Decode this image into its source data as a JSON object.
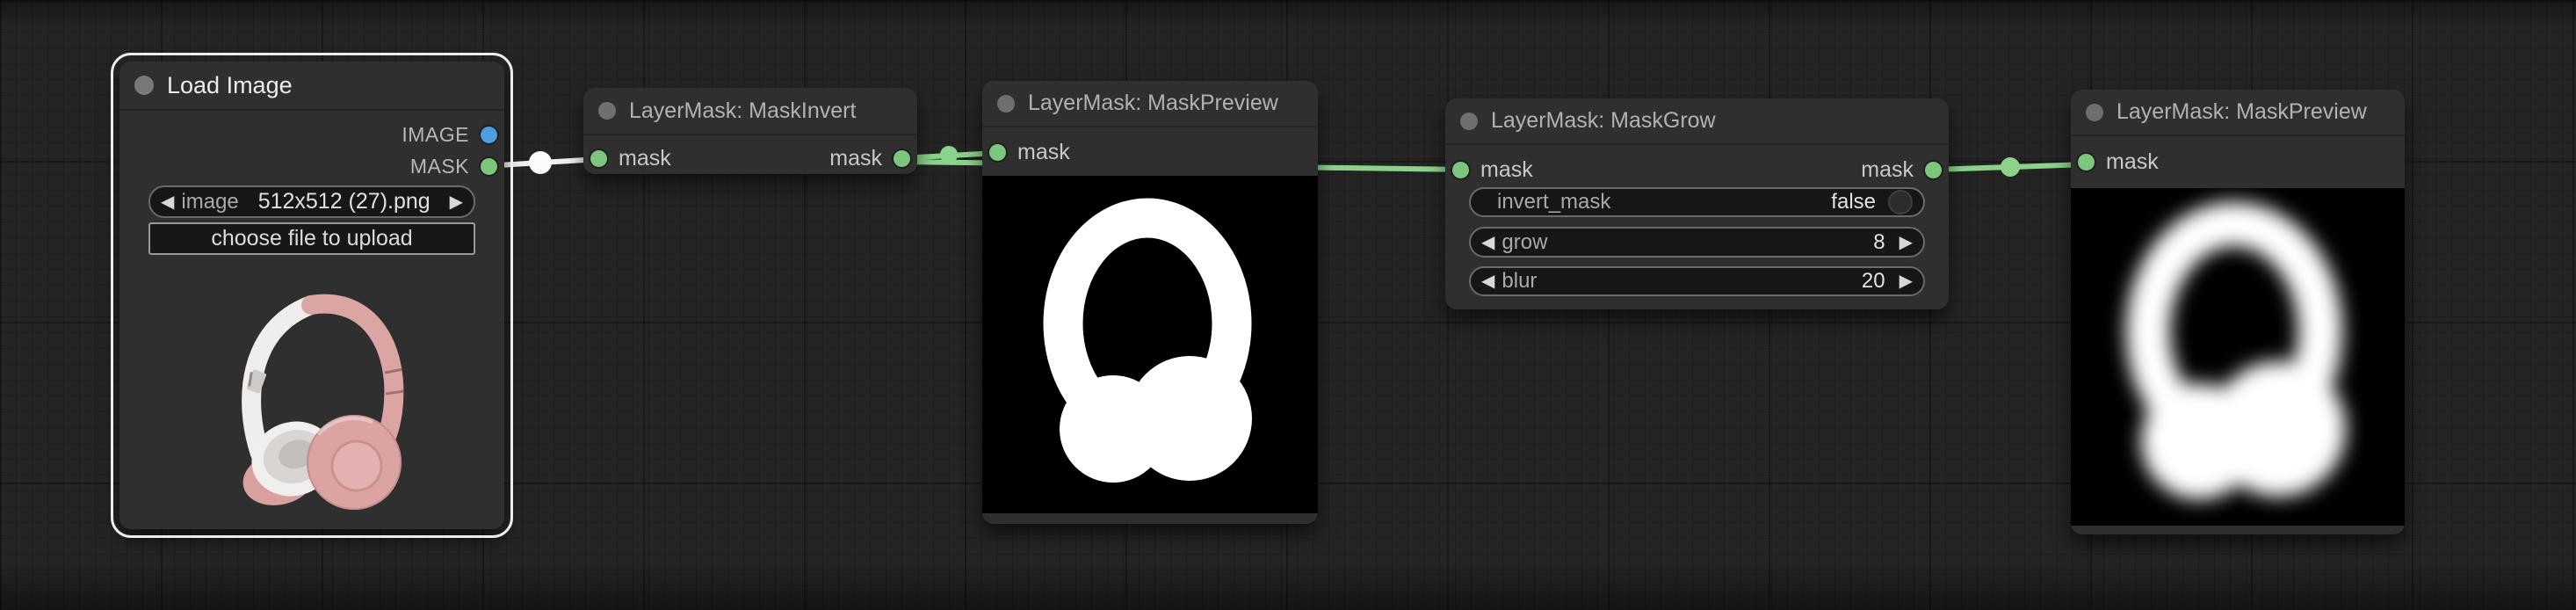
{
  "canvas": {
    "background": "#242424",
    "wire_green": "#8bd38b",
    "wire_white": "#f2f2f2",
    "socket_green": "#7cc77c",
    "socket_blue": "#4d9ee0"
  },
  "icons": {
    "left_arrow": "◀",
    "right_arrow": "▶"
  },
  "nodes": [
    {
      "title": "Load Image",
      "selected": true,
      "outputs": [
        {
          "label": "IMAGE"
        },
        {
          "label": "MASK"
        }
      ],
      "combo": {
        "label": "image",
        "value": "512x512 (27).png"
      },
      "button": {
        "label": "choose file to upload"
      },
      "preview": "headphones-photo"
    },
    {
      "title": "LayerMask: MaskInvert",
      "input": {
        "label": "mask"
      },
      "output": {
        "label": "mask"
      }
    },
    {
      "title": "LayerMask: MaskPreview",
      "input": {
        "label": "mask"
      },
      "preview": "binary-headphones-mask"
    },
    {
      "title": "LayerMask: MaskGrow",
      "input": {
        "label": "mask"
      },
      "output": {
        "label": "mask"
      },
      "widgets": [
        {
          "label": "invert_mask",
          "value": "false"
        },
        {
          "label": "grow",
          "value": "8"
        },
        {
          "label": "blur",
          "value": "20"
        }
      ]
    },
    {
      "title": "LayerMask: MaskPreview",
      "input": {
        "label": "mask"
      },
      "preview": "blurred-headphones-mask"
    }
  ]
}
